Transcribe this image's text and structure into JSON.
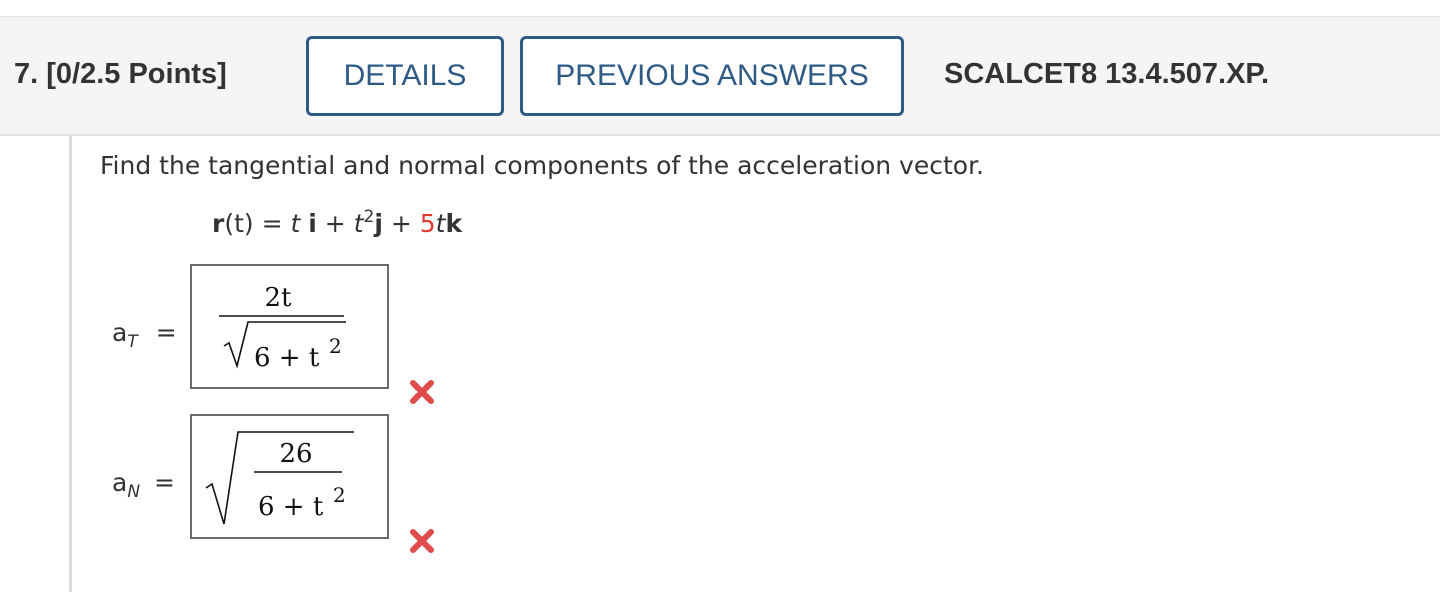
{
  "question": {
    "number": "7.",
    "points": "[0/2.5 Points]",
    "details_label": "DETAILS",
    "previous_answers_label": "PREVIOUS ANSWERS",
    "code": "SCALCET8 13.4.507.XP."
  },
  "prompt": "Find the tangential and normal components of the acceleration vector.",
  "equation": {
    "lhs_r": "r",
    "lhs_arg": "(t)",
    "equals": " = ",
    "t1": "t",
    "i": "i",
    "plus1": " + ",
    "t2": "t",
    "exp": "2",
    "j": "j",
    "plus2": " + ",
    "coef": "5",
    "t3": "t",
    "k": "k"
  },
  "answers": {
    "aT": {
      "var": "a",
      "sub": "T",
      "equals": "=",
      "numerator": "2t",
      "denominator": "6 + t",
      "denominator_exp": "2",
      "status": "incorrect"
    },
    "aN": {
      "var": "a",
      "sub": "N",
      "equals": "=",
      "numerator": "26",
      "denominator": "6 + t",
      "denominator_exp": "2",
      "status": "incorrect"
    }
  },
  "colors": {
    "button_border": "#2d5b86",
    "header_bg": "#f5f5f5",
    "coefficient_red": "#e23a2f",
    "incorrect_mark": "#e04b4b"
  },
  "icons": {
    "incorrect": "x-mark-icon"
  }
}
